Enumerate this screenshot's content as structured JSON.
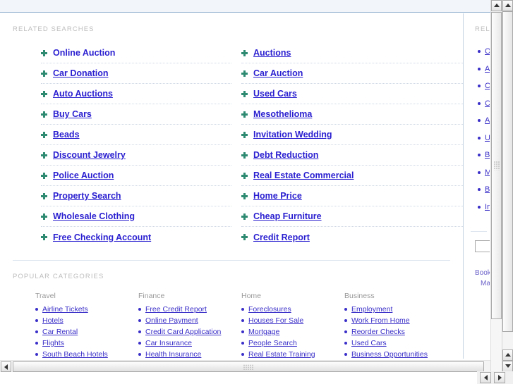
{
  "sections": {
    "related_searches_label": "RELATED SEARCHES",
    "popular_categories_label": "POPULAR CATEGORIES",
    "sidebar_related_label": "RELATED"
  },
  "related_searches": {
    "column_left": [
      "Online Auction",
      "Car Donation",
      "Auto Auctions",
      "Buy Cars",
      "Beads",
      "Discount Jewelry",
      "Police Auction",
      "Property Search",
      "Wholesale Clothing",
      "Free Checking Account"
    ],
    "column_right": [
      "Auctions",
      "Car Auction",
      "Used Cars",
      "Mesothelioma",
      "Invitation Wedding",
      "Debt Reduction",
      "Real Estate Commercial",
      "Home Price",
      "Cheap Furniture",
      "Credit Report"
    ]
  },
  "popular_categories": [
    {
      "heading": "Travel",
      "items": [
        "Airline Tickets",
        "Hotels",
        "Car Rental",
        "Flights",
        "South Beach Hotels"
      ]
    },
    {
      "heading": "Finance",
      "items": [
        "Free Credit Report",
        "Online Payment",
        "Credit Card Application",
        "Car Insurance",
        "Health Insurance"
      ]
    },
    {
      "heading": "Home",
      "items": [
        "Foreclosures",
        "Houses For Sale",
        "Mortgage",
        "People Search",
        "Real Estate Training"
      ]
    },
    {
      "heading": "Business",
      "items": [
        "Employment",
        "Work From Home",
        "Reorder Checks",
        "Used Cars",
        "Business Opportunities"
      ]
    }
  ],
  "sidebar": {
    "items": [
      "Online Auction",
      "Auctions",
      "Car Donation",
      "Car Auction",
      "Auto Auctions",
      "Used Cars",
      "Buy Cars",
      "Mesothelioma",
      "Beads",
      "Invitation Wedding"
    ],
    "search_value": "",
    "search_placeholder": "",
    "footer_links": [
      "Bookmark",
      "Make this"
    ]
  },
  "colors": {
    "link": "#2a1fd0",
    "bullet": "#2e8b72",
    "label": "#bdbdbd",
    "topbar": "#f2f6fb"
  }
}
